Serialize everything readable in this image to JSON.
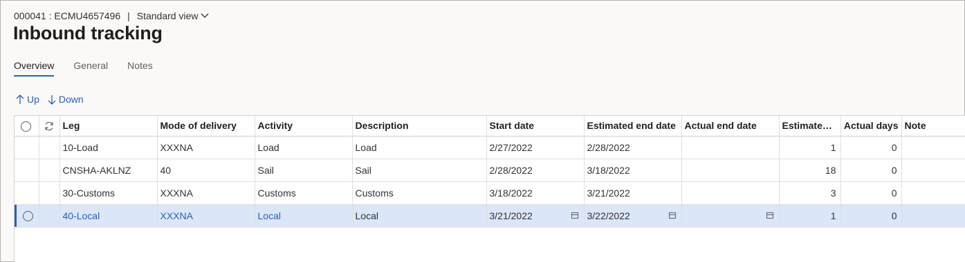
{
  "header": {
    "record": "000041 : ECMU4657496",
    "separator": "|",
    "view": "Standard view"
  },
  "page_title": "Inbound tracking",
  "tabs": [
    {
      "label": "Overview",
      "active": true
    },
    {
      "label": "General",
      "active": false
    },
    {
      "label": "Notes",
      "active": false
    }
  ],
  "toolbar": {
    "up_label": "Up",
    "down_label": "Down"
  },
  "grid": {
    "columns": [
      "Leg",
      "Mode of delivery",
      "Activity",
      "Description",
      "Start date",
      "Estimated end date",
      "Actual end date",
      "Estimated ...",
      "Actual days",
      "Note"
    ],
    "rows": [
      {
        "leg": "10-Load",
        "mode": "XXXNA",
        "activity": "Load",
        "description": "Load",
        "start": "2/27/2022",
        "est_end": "2/28/2022",
        "actual_end": "",
        "est_days": "1",
        "actual_days": "0",
        "note": "",
        "selected": false
      },
      {
        "leg": "CNSHA-AKLNZ",
        "mode": "40",
        "activity": "Sail",
        "description": "Sail",
        "start": "2/28/2022",
        "est_end": "3/18/2022",
        "actual_end": "",
        "est_days": "18",
        "actual_days": "0",
        "note": "",
        "selected": false
      },
      {
        "leg": "30-Customs",
        "mode": "XXXNA",
        "activity": "Customs",
        "description": "Customs",
        "start": "3/18/2022",
        "est_end": "3/21/2022",
        "actual_end": "",
        "est_days": "3",
        "actual_days": "0",
        "note": "",
        "selected": false
      },
      {
        "leg": "40-Local",
        "mode": "XXXNA",
        "activity": "Local",
        "description": "Local",
        "start": "3/21/2022",
        "est_end": "3/22/2022",
        "actual_end": "",
        "est_days": "1",
        "actual_days": "0",
        "note": "",
        "selected": true
      }
    ]
  },
  "colors": {
    "accent": "#2b5fb4",
    "selected_row": "#dbe6f8"
  }
}
